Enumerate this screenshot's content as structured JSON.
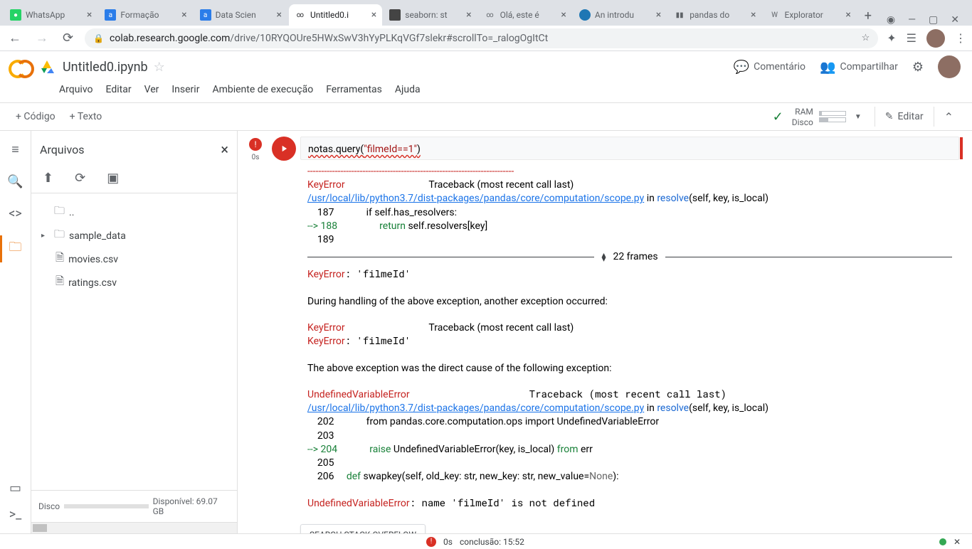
{
  "browser": {
    "tabs": [
      {
        "title": "WhatsApp",
        "fav": "#25d366"
      },
      {
        "title": "Formação",
        "fav": "#2b7de9"
      },
      {
        "title": "Data Scien",
        "fav": "#2b7de9"
      },
      {
        "title": "Untitled0.i",
        "fav": "#f9ab00",
        "active": true
      },
      {
        "title": "seaborn: st",
        "fav": "#444"
      },
      {
        "title": "Olá, este é",
        "fav": "#f9ab00"
      },
      {
        "title": "An introdu",
        "fav": "#1f77b4"
      },
      {
        "title": "pandas do",
        "fav": "#666"
      },
      {
        "title": "Explorator",
        "fav": "#666"
      }
    ],
    "url_domain": "colab.research.google.com",
    "url_path": "/drive/10RYQOUre5HWxSwV3hYyPLKqVGf7slekr#scrollTo=_ralogOgItCt"
  },
  "colab": {
    "file_name": "Untitled0.ipynb",
    "comment": "Comentário",
    "share": "Compartilhar",
    "menus": [
      "Arquivo",
      "Editar",
      "Ver",
      "Inserir",
      "Ambiente de execução",
      "Ferramentas",
      "Ajuda"
    ],
    "toolbar": {
      "code": "+ Código",
      "text": "+ Texto",
      "ram": "RAM",
      "disk": "Disco",
      "edit": "Editar"
    }
  },
  "files_panel": {
    "title": "Arquivos",
    "tree": {
      "up": "..",
      "folder": "sample_data",
      "files": [
        "movies.csv",
        "ratings.csv"
      ]
    },
    "footer_disk": "Disco",
    "footer_avail": "Disponível: 69.07 GB"
  },
  "cell": {
    "exec_time": "0s",
    "code_prefix": "notas.query(",
    "code_str": "\"filmeId==1\"",
    "code_suffix": ")",
    "output": {
      "dashes": "---------------------------------------------------------------------------",
      "err1": "KeyError",
      "trace": "                                  Traceback (most recent call last)",
      "link": "/usr/local/lib/python3.7/dist-packages/pandas/core/computation/scope.py",
      "link_suffix_in": " in ",
      "resolve": "resolve",
      "resolve_args": "(self, key, is_local)",
      "l187": "    187             if self.has_resolvers:",
      "l188a": "--> 188                 ",
      "l188_ret": "return",
      "l188b": " self.resolvers[key]",
      "l189": "    189 ",
      "frames": "22 frames",
      "key_filme": "KeyError: 'filmeId'",
      "during": "During handling of the above exception, another exception occurred:",
      "above": "The above exception was the direct cause of the following exception:",
      "unverr": "UndefinedVariableError",
      "l202": "    202             from pandas.core.computation.ops import UndefinedVariableError",
      "l203": "    203 ",
      "l204a": "--> 204             ",
      "l204_raise": "raise",
      "l204b": " UndefinedVariableError(key, is_local) ",
      "l204_from": "from",
      "l204c": " err",
      "l205": "    205 ",
      "l206a": "    206     ",
      "l206_def": "def",
      "l206b": " swapkey(self, old_key: str, new_key: str, new_value=",
      "l206_none": "None",
      "l206c": "):",
      "final": "UndefinedVariableError: name 'filmeId' is not defined",
      "so_btn": "SEARCH STACK OVERFLOW"
    }
  },
  "status": {
    "time": "0s",
    "conclusion": "conclusão: 15:52"
  }
}
